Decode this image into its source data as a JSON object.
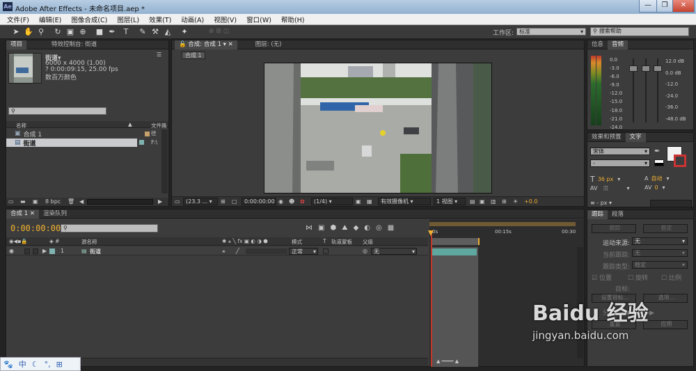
{
  "window": {
    "title": "Adobe After Effects - 未命名项目.aep *",
    "app_badge": "Ae",
    "minimize": "—",
    "maximize": "❐",
    "close": "✕"
  },
  "menu": [
    "文件(F)",
    "编辑(E)",
    "图像合成(C)",
    "图层(L)",
    "效果(T)",
    "动画(A)",
    "视图(V)",
    "窗口(W)",
    "帮助(H)"
  ],
  "toolbar": {
    "workspace_label": "工作区:",
    "workspace_value": "标准",
    "search_placeholder": "搜索帮助"
  },
  "project": {
    "tabs": [
      "项目",
      "特效控制台: 街道"
    ],
    "item_name": "街道▾",
    "item_size": "6000 x 4000 (1.00)",
    "item_duration": "? 0:00:09:15, 25.00 fps",
    "item_color": "数百万颜色",
    "col_name": "名称",
    "col_file": "文件路径",
    "rows": [
      {
        "name": "合成 1",
        "file": ""
      },
      {
        "name": "街道",
        "file": "F:\\"
      }
    ],
    "bpc": "8 bpc"
  },
  "viewer": {
    "tab_comp": "合成: 合成 1",
    "tab_layer": "图层: (无)",
    "crumb": "合成 1",
    "zoom": "(23.3 ...",
    "timecode": "0:00:00:00",
    "resolution": "(1/4)",
    "camera": "有效摄像机",
    "views": "1 视图",
    "exposure": "+0.0"
  },
  "info": {
    "tabs": [
      "信息",
      "音频"
    ],
    "db_left": [
      "0.0",
      "-3.0",
      "-6.0",
      "-9.0",
      "-12.0",
      "-15.0",
      "-18.0",
      "-21.0",
      "-24.0"
    ],
    "db_right": [
      "12.0 dB",
      "0.0 dB",
      "-12.0",
      "-24.0",
      "-36.0",
      "-48.0 dB"
    ]
  },
  "effects": {
    "tabs": [
      "效果和预置",
      "文字"
    ],
    "font": "宋体",
    "style": "-",
    "size": "36 px",
    "leading": "自动",
    "tracking": "0",
    "unit": "px"
  },
  "tracker": {
    "tabs": [
      "跟踪",
      "段落"
    ],
    "track_btn": "跟踪",
    "stable_btn": "稳定",
    "motion_source": "运动来源:",
    "motion_value": "无",
    "current_track": "当前跟踪:",
    "current_value": "无",
    "track_type": "跟踪类型:",
    "track_type_value": "稳定",
    "position": "位置",
    "rotation": "旋转",
    "scale": "比例",
    "target": "目标:",
    "set_target": "设置目标...",
    "options": "选项...",
    "analyze": "分析:",
    "apply": "应用",
    "reset": "重置"
  },
  "timeline": {
    "tabs": [
      "合成 1",
      "渲染队列"
    ],
    "timecode": "0:00:00:00",
    "col_src": "源名称",
    "col_mode": "模式",
    "col_t": "T",
    "col_trkmat": "轨道蒙板",
    "col_parent": "父级",
    "layer_num": "1",
    "layer_name": "街道",
    "layer_mode": "正常",
    "layer_parent": "无",
    "ruler": [
      "0s",
      "00:15s",
      "00:30"
    ]
  },
  "taskbar": {
    "ime": "中",
    "icons": [
      "paw-icon",
      "moon-icon",
      "comma-icon",
      "grid-icon"
    ]
  },
  "watermark": {
    "brand": "Baidu 经验",
    "url": "jingyan.baidu.com"
  },
  "colors": {
    "accent": "#f0b030",
    "selection": "#c9cbcf",
    "teal": "#5fa8a0"
  }
}
